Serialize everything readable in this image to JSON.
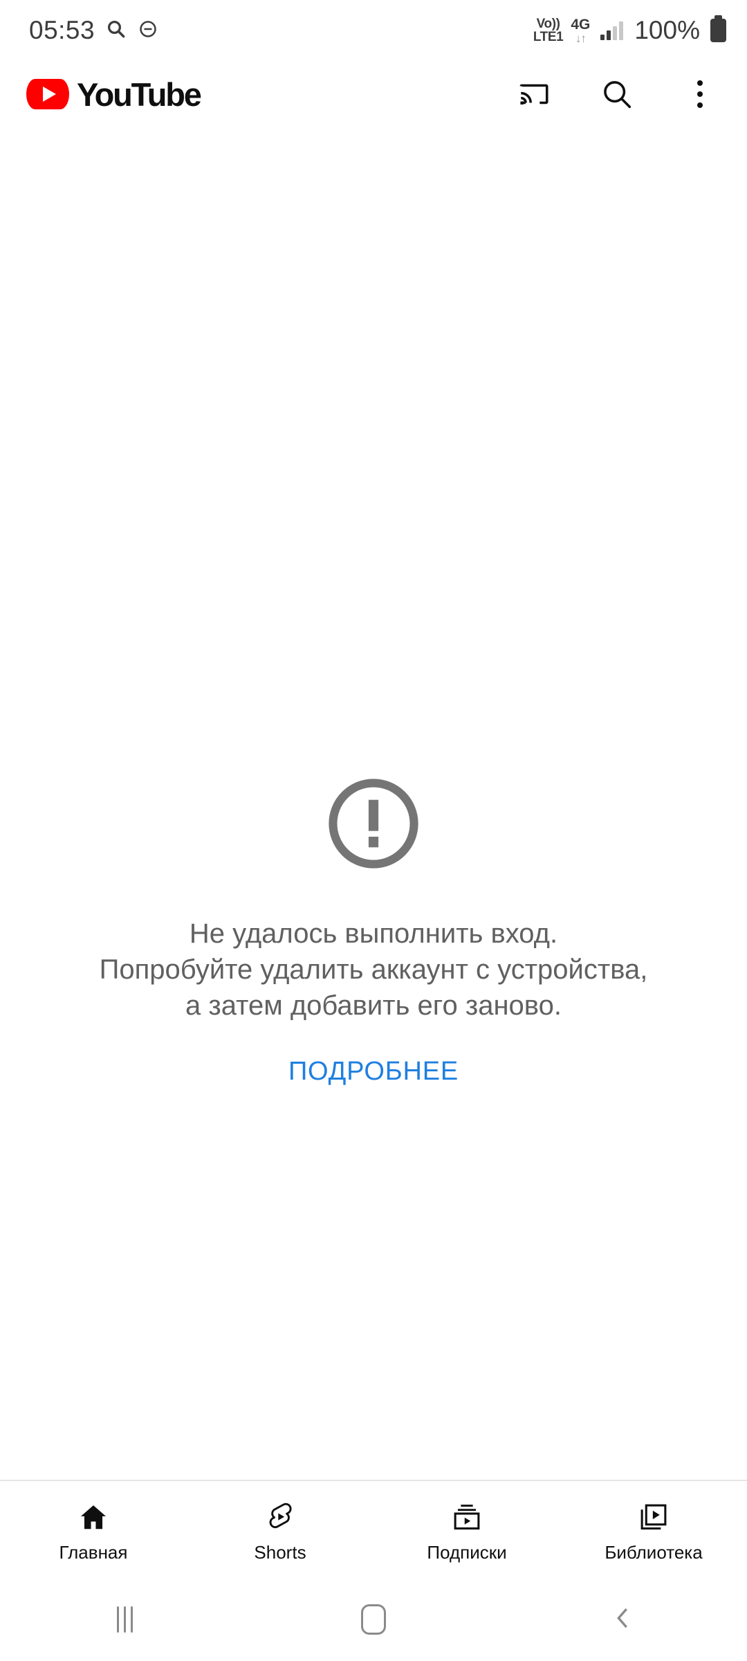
{
  "status_bar": {
    "time": "05:53",
    "icons": [
      "search-icon",
      "do-not-disturb-icon"
    ],
    "volte_top": "Vo))",
    "volte_bottom": "LTE1",
    "network_type": "4G",
    "data_arrows": "↓↑",
    "battery_percent": "100%"
  },
  "app_header": {
    "brand": "YouTube",
    "actions": [
      {
        "name": "cast-button",
        "label": "Cast"
      },
      {
        "name": "search-button",
        "label": "Search"
      },
      {
        "name": "more-options-button",
        "label": "More options"
      }
    ]
  },
  "error": {
    "icon": "error-circle-icon",
    "icon_color": "#757575",
    "text_color": "#606060",
    "lines": [
      "Не удалось выполнить вход.",
      "Попробуйте удалить аккаунт с устройства,",
      "а затем добавить его заново."
    ],
    "learn_more_label": "ПОДРОБНЕЕ",
    "learn_more_color": "#1f7fe0"
  },
  "bottom_nav": {
    "items": [
      {
        "name": "nav-home",
        "label": "Главная",
        "icon": "home-icon",
        "active": true
      },
      {
        "name": "nav-shorts",
        "label": "Shorts",
        "icon": "shorts-icon",
        "active": false
      },
      {
        "name": "nav-subscriptions",
        "label": "Подписки",
        "icon": "subscriptions-icon",
        "active": false
      },
      {
        "name": "nav-library",
        "label": "Библиотека",
        "icon": "library-icon",
        "active": false
      }
    ]
  },
  "system_nav": {
    "buttons": [
      {
        "name": "recents-button",
        "icon": "recents-icon"
      },
      {
        "name": "home-button",
        "icon": "home-square-icon"
      },
      {
        "name": "back-button",
        "icon": "chevron-left-icon"
      }
    ]
  }
}
